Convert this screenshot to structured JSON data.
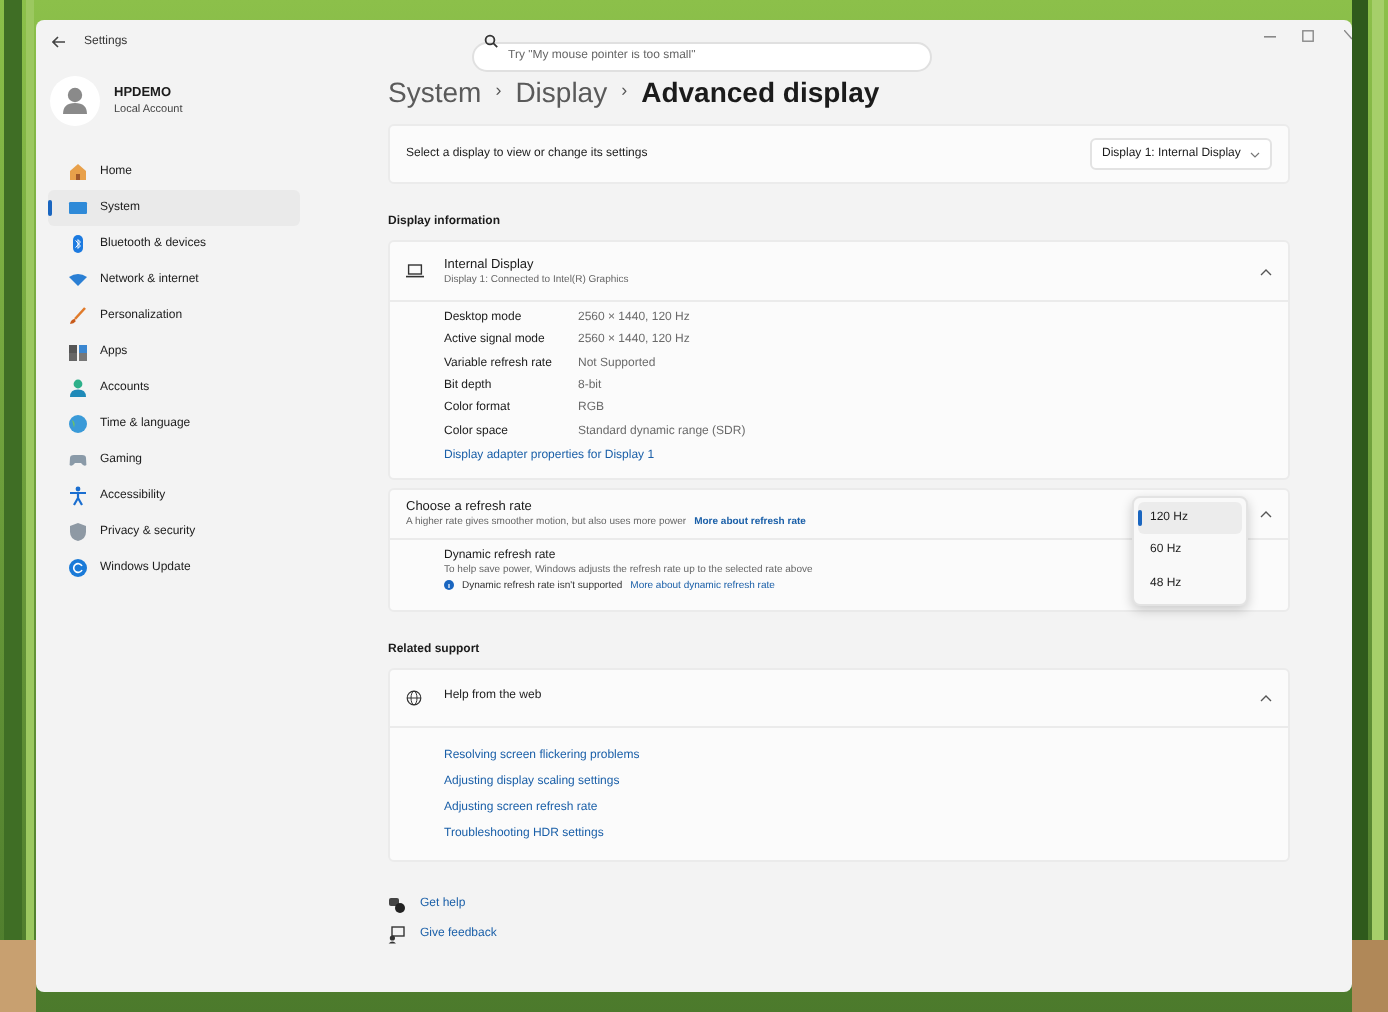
{
  "window": {
    "title": "Settings"
  },
  "search": {
    "placeholder": "Try \"My mouse pointer is too small\""
  },
  "account": {
    "name": "HPDEMO",
    "type": "Local Account"
  },
  "sidebar": {
    "items": [
      {
        "label": "Home",
        "selected": false
      },
      {
        "label": "System",
        "selected": true
      },
      {
        "label": "Bluetooth & devices",
        "selected": false
      },
      {
        "label": "Network & internet",
        "selected": false
      },
      {
        "label": "Personalization",
        "selected": false
      },
      {
        "label": "Apps",
        "selected": false
      },
      {
        "label": "Accounts",
        "selected": false
      },
      {
        "label": "Time & language",
        "selected": false
      },
      {
        "label": "Gaming",
        "selected": false
      },
      {
        "label": "Accessibility",
        "selected": false
      },
      {
        "label": "Privacy & security",
        "selected": false
      },
      {
        "label": "Windows Update",
        "selected": false
      }
    ]
  },
  "breadcrumb": [
    {
      "kind": "link",
      "text": "System"
    },
    {
      "kind": "separator",
      "text": "›"
    },
    {
      "kind": "link",
      "text": "Display"
    },
    {
      "kind": "separator",
      "text": "›"
    },
    {
      "kind": "current",
      "text": "Advanced display"
    }
  ],
  "display_select": {
    "label": "Select a display to view or change its settings",
    "value": "Display 1: Internal Display"
  },
  "display_information": {
    "heading": "Display information",
    "title": "Internal Display",
    "subtitle": "Display 1: Connected to Intel(R) Graphics",
    "expanded": true,
    "rows": [
      {
        "label": "Desktop mode",
        "value": "2560 × 1440, 120 Hz"
      },
      {
        "label": "Active signal mode",
        "value": "2560 × 1440, 120 Hz"
      },
      {
        "label": "Variable refresh rate",
        "value": "Not Supported"
      },
      {
        "label": "Bit depth",
        "value": "8-bit"
      },
      {
        "label": "Color format",
        "value": "RGB"
      },
      {
        "label": "Color space",
        "value": "Standard dynamic range (SDR)"
      }
    ],
    "link": "Display adapter properties for Display 1"
  },
  "refresh_rate": {
    "title": "Choose a refresh rate",
    "description": "A higher rate gives smoother motion, but also uses more power",
    "link": "More about refresh rate",
    "expanded": true,
    "options": [
      {
        "label": "120 Hz",
        "selected": true
      },
      {
        "label": "60 Hz",
        "selected": false
      },
      {
        "label": "48 Hz",
        "selected": false
      }
    ],
    "dynamic": {
      "title": "Dynamic refresh rate",
      "description": "To help save power, Windows adjusts the refresh rate up to the selected rate above",
      "status": "Dynamic refresh rate isn't supported",
      "link": "More about dynamic refresh rate"
    }
  },
  "related_support": {
    "heading": "Related support",
    "title": "Help from the web",
    "expanded": true,
    "links": [
      "Resolving screen flickering problems",
      "Adjusting display scaling settings",
      "Adjusting screen refresh rate",
      "Troubleshooting HDR settings"
    ]
  },
  "footer_links": [
    "Get help",
    "Give feedback"
  ]
}
